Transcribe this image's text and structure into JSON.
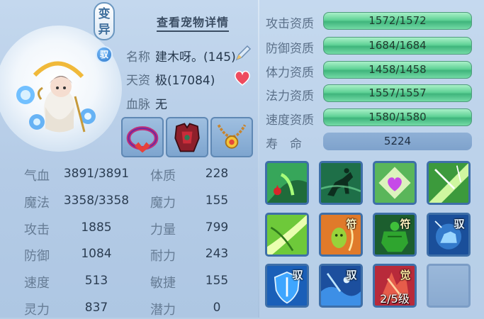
{
  "pet": {
    "mutation_badge": "变异",
    "bind_badge": "驭",
    "detail_link": "查看宠物详情",
    "name_label": "名称",
    "name_value": "建木呀。(145)",
    "talent_label": "天资",
    "talent_value": "极(17084)",
    "bloodline_label": "血脉",
    "bloodline_value": "无"
  },
  "equipment": [
    {
      "icon": "collar-icon"
    },
    {
      "icon": "armor-icon"
    },
    {
      "icon": "necklace-icon"
    }
  ],
  "stats": [
    {
      "label": "气血",
      "value": "3891/3891",
      "label2": "体质",
      "value2": "228"
    },
    {
      "label": "魔法",
      "value": "3358/3358",
      "label2": "魔力",
      "value2": "155"
    },
    {
      "label": "攻击",
      "value": "1885",
      "label2": "力量",
      "value2": "799"
    },
    {
      "label": "防御",
      "value": "1084",
      "label2": "耐力",
      "value2": "243"
    },
    {
      "label": "速度",
      "value": "513",
      "label2": "敏捷",
      "value2": "155"
    },
    {
      "label": "灵力",
      "value": "837",
      "label2": "潜力",
      "value2": "0"
    }
  ],
  "aptitudes": [
    {
      "label": "攻击资质",
      "value": "1572/1572",
      "fill": 1.0
    },
    {
      "label": "防御资质",
      "value": "1684/1684",
      "fill": 1.0
    },
    {
      "label": "体力资质",
      "value": "1458/1458",
      "fill": 1.0
    },
    {
      "label": "法力资质",
      "value": "1557/1557",
      "fill": 1.0
    },
    {
      "label": "速度资质",
      "value": "1580/1580",
      "fill": 1.0
    }
  ],
  "lifespan": {
    "label": "寿　命",
    "value": "5224"
  },
  "skills": [
    {
      "icon": "blood-drain-skill-icon",
      "tag": ""
    },
    {
      "icon": "horse-rider-skill-icon",
      "tag": ""
    },
    {
      "icon": "heart-skill-icon",
      "tag": ""
    },
    {
      "icon": "light-burst-skill-icon",
      "tag": ""
    },
    {
      "icon": "leaf-slash-skill-icon",
      "tag": ""
    },
    {
      "icon": "ghost-skill-icon",
      "tag": "符"
    },
    {
      "icon": "hulk-skill-icon",
      "tag": "符"
    },
    {
      "icon": "ice-beast-skill-icon",
      "tag": "驭"
    },
    {
      "icon": "shield-skill-icon",
      "tag": "驭"
    },
    {
      "icon": "water-wave-skill-icon",
      "tag": "驭"
    },
    {
      "icon": "awaken-skill-icon",
      "tag": "觉",
      "level": "2/5级"
    },
    {
      "icon": "empty-slot",
      "tag": ""
    }
  ],
  "colors": {
    "bar_green": "#5fd196",
    "panel_bg": "#b7cfe6",
    "text_dark": "#26384d"
  }
}
